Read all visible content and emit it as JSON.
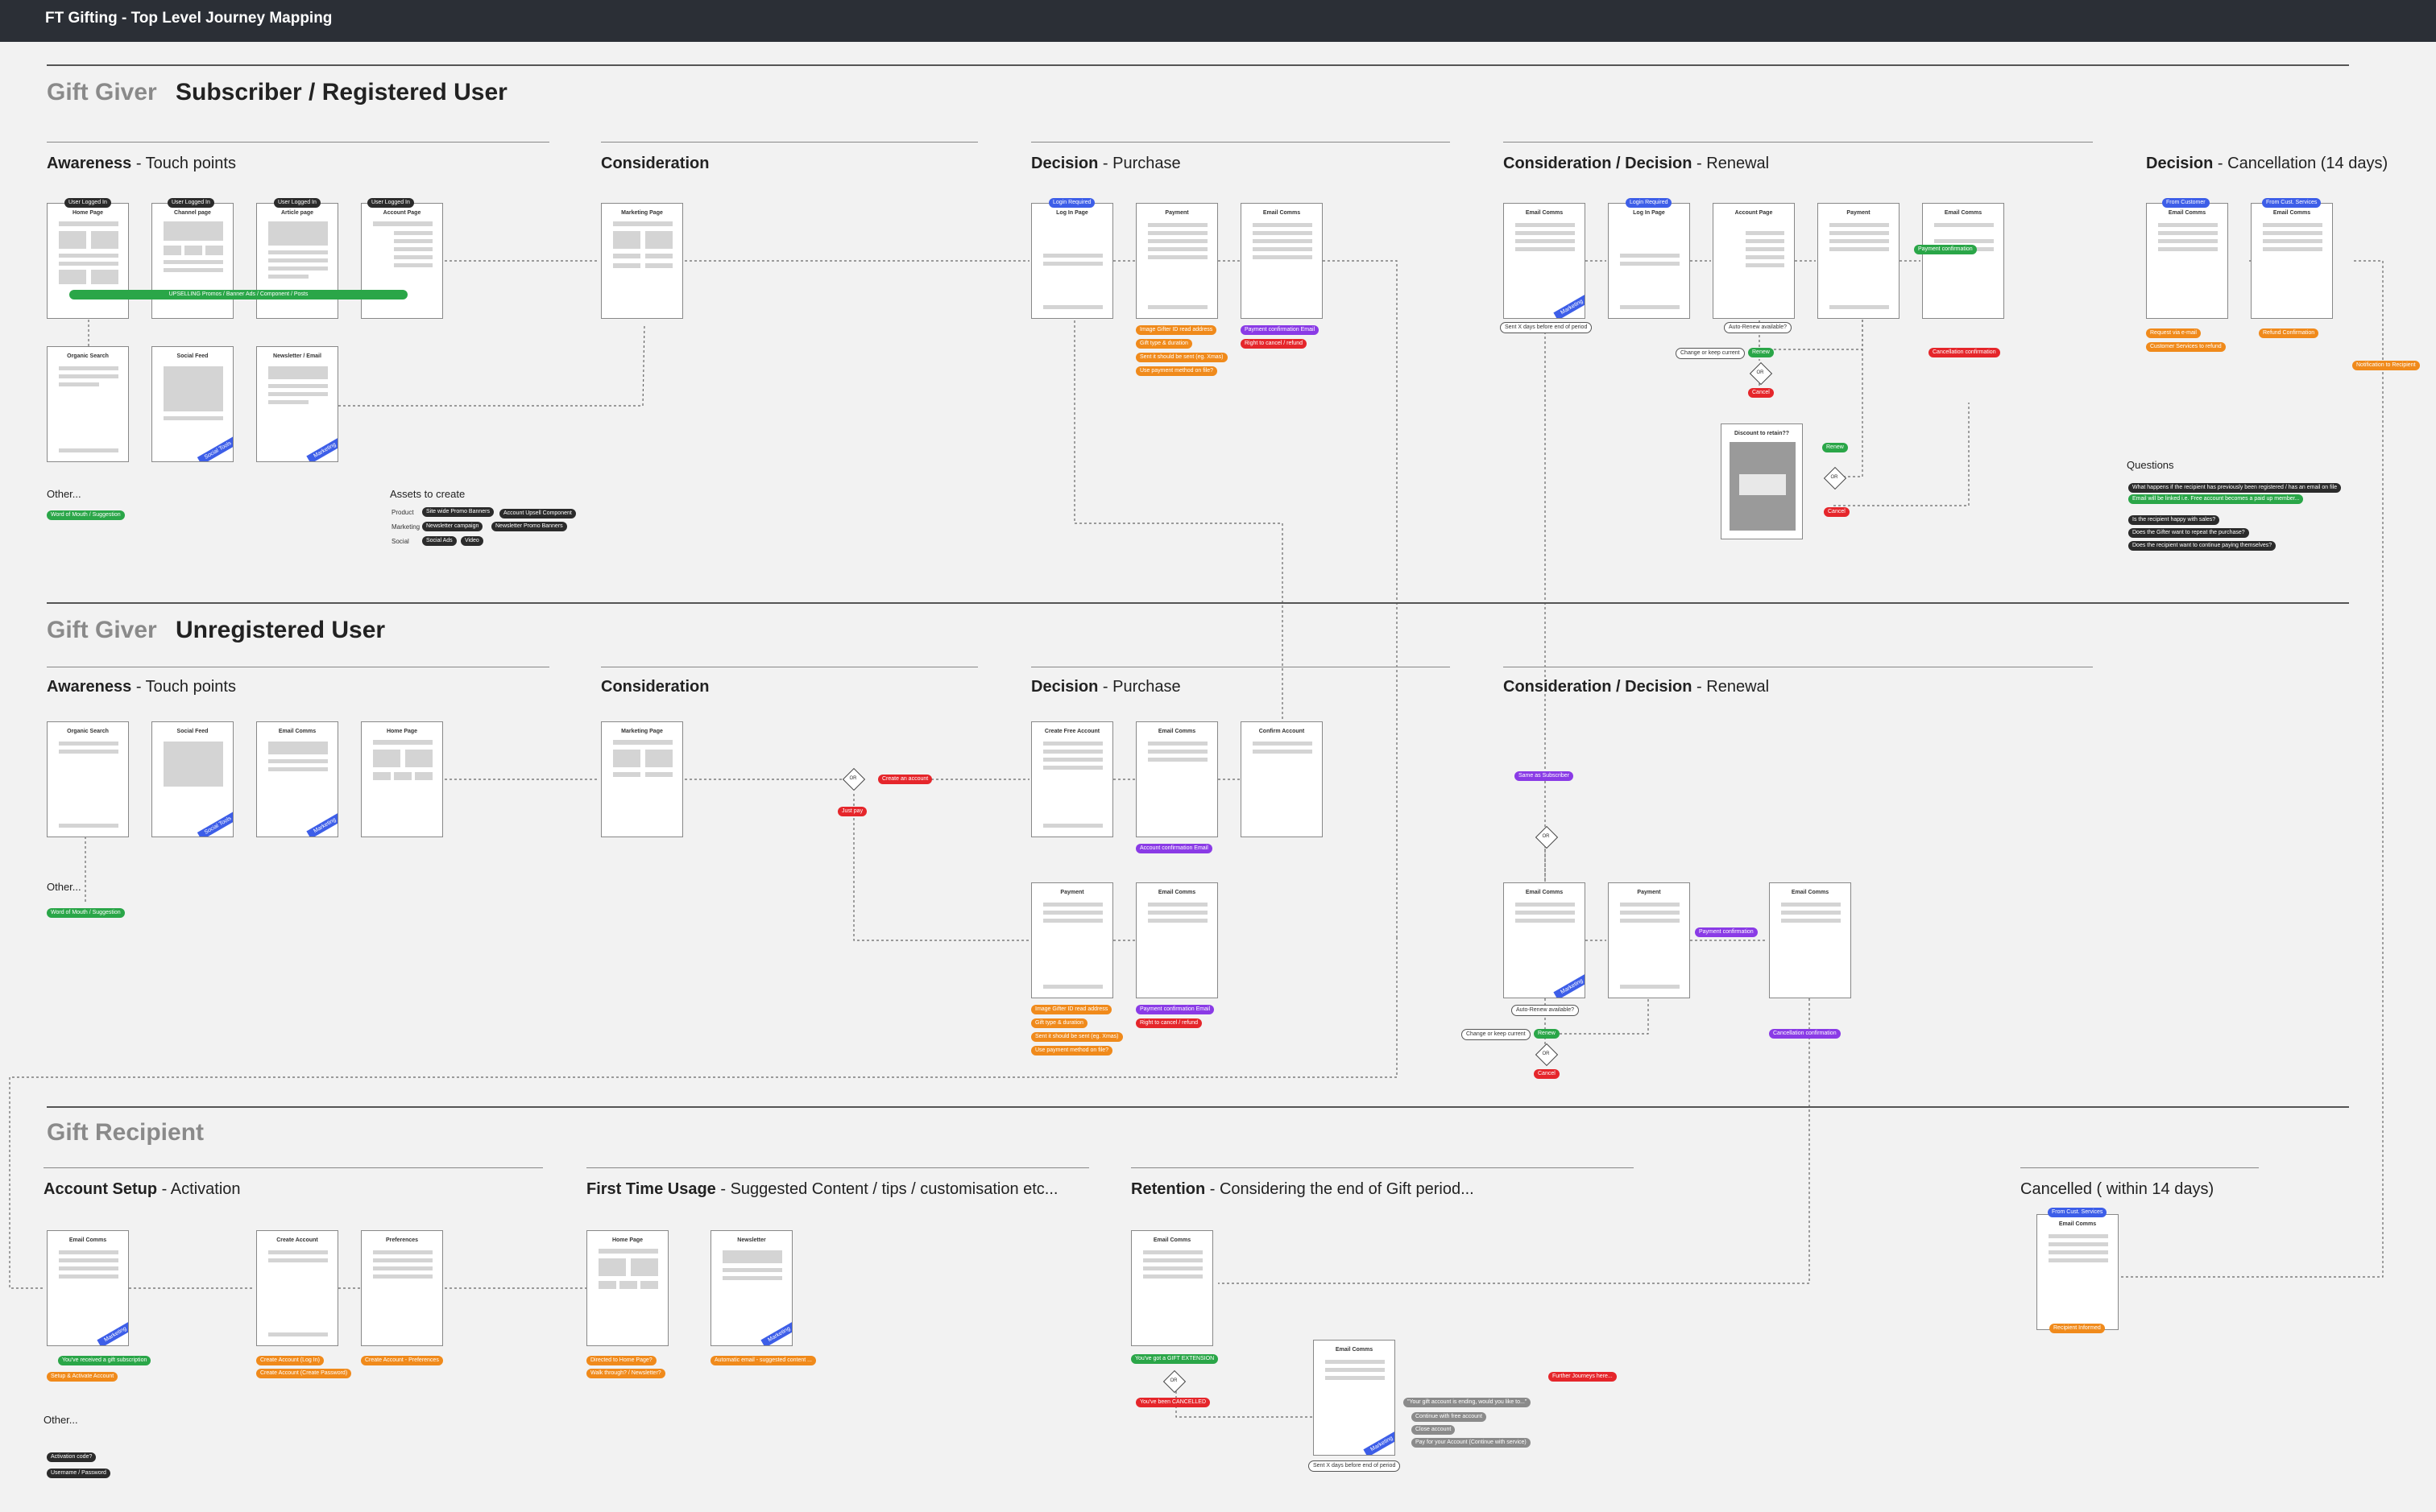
{
  "app": {
    "title": "FT Gifting - Top Level Journey Mapping"
  },
  "sections": {
    "s1": {
      "label_grey": "Gift Giver",
      "label": "Subscriber / Registered User"
    },
    "s2": {
      "label_grey": "Gift Giver",
      "label": "Unregistered User"
    },
    "s3": {
      "label": "Gift Recipient"
    }
  },
  "stages": {
    "s1_awareness": {
      "bold": "Awareness",
      "rest": " - Touch points"
    },
    "s1_consideration": {
      "bold": "Consideration",
      "rest": ""
    },
    "s1_decision": {
      "bold": "Decision",
      "rest": " - Purchase"
    },
    "s1_renewal": {
      "bold": "Consideration / Decision",
      "rest": " - Renewal"
    },
    "s1_cancel": {
      "bold": "Decision",
      "rest": " - Cancellation (14 days)"
    },
    "s2_awareness": {
      "bold": "Awareness",
      "rest": " - Touch points"
    },
    "s2_consideration": {
      "bold": "Consideration",
      "rest": ""
    },
    "s2_decision": {
      "bold": "Decision",
      "rest": " - Purchase"
    },
    "s2_renewal": {
      "bold": "Consideration / Decision",
      "rest": " - Renewal"
    },
    "s3_setup": {
      "bold": "Account Setup",
      "rest": " - Activation"
    },
    "s3_first": {
      "bold": "First Time Usage",
      "rest": " - Suggested Content / tips / customisation etc..."
    },
    "s3_retention": {
      "bold": "Retention",
      "rest": " - Considering the end of Gift period..."
    },
    "s3_cancelled": {
      "bold": "Cancelled ( within 14 days)",
      "rest": ""
    }
  },
  "frames": {
    "s1_home": "Home Page",
    "s1_channel": "Channel page",
    "s1_article": "Article page",
    "s1_account": "Account Page",
    "s1_organic": "Organic Search",
    "s1_social": "Social Feed",
    "s1_newsletter": "Newsletter / Email",
    "s1_marketing": "Marketing Page",
    "s1_login": "Log In Page",
    "s1_payment": "Payment",
    "s1_email": "Email Comms",
    "s1_r_email": "Email Comms",
    "s1_r_login": "Log In Page",
    "s1_r_account": "Account Page",
    "s1_r_payment": "Payment",
    "s1_r_email2": "Email Comms",
    "s1_r_discount": "Discount to retain??",
    "s1_c_email1": "Email Comms",
    "s1_c_email2": "Email Comms",
    "s2_organic": "Organic Search",
    "s2_social": "Social Feed",
    "s2_email": "Email Comms",
    "s2_home": "Home Page",
    "s2_marketing": "Marketing Page",
    "s2_create": "Create Free Account",
    "s2_email2": "Email Comms",
    "s2_confirm": "Confirm Account",
    "s2_payment": "Payment",
    "s2_email3": "Email Comms",
    "s2_r_email": "Email Comms",
    "s2_r_payment": "Payment",
    "s2_r_email2": "Email Comms",
    "s3_email": "Email Comms",
    "s3_create": "Create Account",
    "s3_prefs": "Preferences",
    "s3_home": "Home Page",
    "s3_newsletter": "Newsletter",
    "s3_ret_email": "Email Comms",
    "s3_ret_email2": "Email Comms",
    "s3_cancel_email": "Email Comms"
  },
  "pills": {
    "logged_in": "User Logged In",
    "login_required": "Login Required",
    "upselling": "UPSELLING Promos / Banner Ads / Component / Posts",
    "social_tools": "Social Tools",
    "marketing": "Marketing",
    "word_of_mouth": "Word of Mouth / Suggestion",
    "other": "Other...",
    "d_image_gifter": "Image Gifter ID read address",
    "d_gift_type": "Gift type & duration",
    "d_when_sent": "Sent it should be sent (eg. Xmas)",
    "d_use_payment": "Use payment method on file?",
    "d_payment_conf": "Payment confirmation Email",
    "d_right_cancel": "Right to cancel / refund",
    "r_sent_days": "Sent X days before end of period",
    "r_auto_renew": "Auto-Renew available?",
    "r_change": "Change or keep current",
    "r_renew": "Renew",
    "r_cancel": "Cancel",
    "r_or": "OR",
    "r_payment_conf": "Payment confirmation",
    "r_cancel_conf": "Cancellation confirmation",
    "c_from_customer": "From Customer",
    "c_from_cs": "From Cust. Services",
    "c_request": "Request via e-mail",
    "c_customer_services": "Customer Services to refund",
    "c_refund": "Refund Confirmation",
    "c_notify": "Notification to Recipient",
    "s2_create_account": "Create an account",
    "s2_just_pay": "Just pay",
    "s2_acc_conf": "Account confirmation Email",
    "s2_same_sub": "Same as Subscriber",
    "s2_payment_conf": "Payment confirmation",
    "s2_cancel_conf": "Cancellation confirmation",
    "s3_received": "You've received a gift subscription",
    "s3_setup": "Setup & Activate Account",
    "s3_create_acc": "Create Account (Log In)",
    "s3_create_pw": "Create Account (Create Password)",
    "s3_prefs": "Create Account - Preferences",
    "s3_directed": "Directed to Home Page?",
    "s3_walk": "Walk through? / Newsletter?",
    "s3_auto_email": "Automatic email - suggested content ...",
    "s3_gift_ext": "You've got a GIFT EXTENSION",
    "s3_cancelled": "You've been CANCELLED",
    "s3_ending": "\"Your gift account is ending, would you like to...\"",
    "s3_continue": "Continue with free account",
    "s3_close": "Close account",
    "s3_pay": "Pay for your Account (Continue with service)",
    "s3_further": "Further Journeys here...",
    "s3_sent_days": "Sent X days before end of period",
    "s3_activation": "Activation code?",
    "s3_username": "Username / Password",
    "s3_recipient_informed": "Recipient Informed"
  },
  "assets": {
    "title": "Assets to create",
    "product_label": "Product",
    "marketing_label": "Marketing",
    "social_label": "Social",
    "product": [
      "Site wide Promo Banners",
      "Account Upsell Component"
    ],
    "marketing": [
      "Newsletter campaign",
      "Newsletter Promo Banners"
    ],
    "social": [
      "Social Ads",
      "Video"
    ]
  },
  "questions": {
    "title": "Questions",
    "items": [
      "What happens if the recipient has previously been registered / has an email on file",
      "Email will be linked i.e. Free account becomes a paid up member...",
      "Is the recipient happy with sales?",
      "Does the Gifter want to repeat the purchase?",
      "Does the recipient want to continue paying themselves?"
    ]
  },
  "colors": {
    "topbar": "#2b2f36",
    "blue": "#3d5ee8",
    "orange": "#f08a1b",
    "red": "#e5262b",
    "purple": "#8a3be6",
    "green": "#2aa648"
  }
}
